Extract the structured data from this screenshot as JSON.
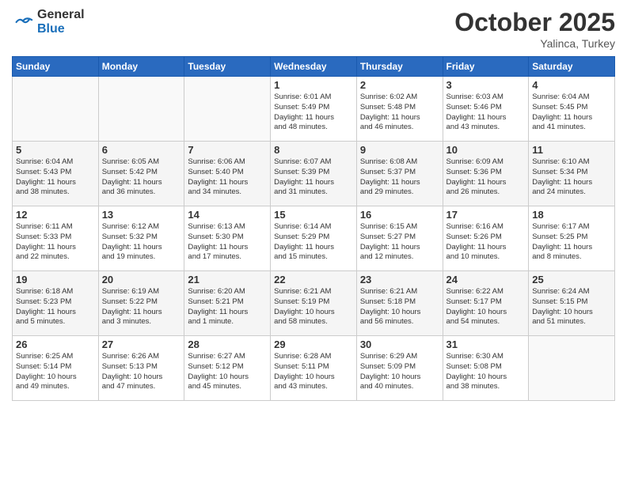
{
  "header": {
    "logo_general": "General",
    "logo_blue": "Blue",
    "month": "October 2025",
    "location": "Yalinca, Turkey"
  },
  "weekdays": [
    "Sunday",
    "Monday",
    "Tuesday",
    "Wednesday",
    "Thursday",
    "Friday",
    "Saturday"
  ],
  "weeks": [
    [
      {
        "day": "",
        "info": ""
      },
      {
        "day": "",
        "info": ""
      },
      {
        "day": "",
        "info": ""
      },
      {
        "day": "1",
        "info": "Sunrise: 6:01 AM\nSunset: 5:49 PM\nDaylight: 11 hours\nand 48 minutes."
      },
      {
        "day": "2",
        "info": "Sunrise: 6:02 AM\nSunset: 5:48 PM\nDaylight: 11 hours\nand 46 minutes."
      },
      {
        "day": "3",
        "info": "Sunrise: 6:03 AM\nSunset: 5:46 PM\nDaylight: 11 hours\nand 43 minutes."
      },
      {
        "day": "4",
        "info": "Sunrise: 6:04 AM\nSunset: 5:45 PM\nDaylight: 11 hours\nand 41 minutes."
      }
    ],
    [
      {
        "day": "5",
        "info": "Sunrise: 6:04 AM\nSunset: 5:43 PM\nDaylight: 11 hours\nand 38 minutes."
      },
      {
        "day": "6",
        "info": "Sunrise: 6:05 AM\nSunset: 5:42 PM\nDaylight: 11 hours\nand 36 minutes."
      },
      {
        "day": "7",
        "info": "Sunrise: 6:06 AM\nSunset: 5:40 PM\nDaylight: 11 hours\nand 34 minutes."
      },
      {
        "day": "8",
        "info": "Sunrise: 6:07 AM\nSunset: 5:39 PM\nDaylight: 11 hours\nand 31 minutes."
      },
      {
        "day": "9",
        "info": "Sunrise: 6:08 AM\nSunset: 5:37 PM\nDaylight: 11 hours\nand 29 minutes."
      },
      {
        "day": "10",
        "info": "Sunrise: 6:09 AM\nSunset: 5:36 PM\nDaylight: 11 hours\nand 26 minutes."
      },
      {
        "day": "11",
        "info": "Sunrise: 6:10 AM\nSunset: 5:34 PM\nDaylight: 11 hours\nand 24 minutes."
      }
    ],
    [
      {
        "day": "12",
        "info": "Sunrise: 6:11 AM\nSunset: 5:33 PM\nDaylight: 11 hours\nand 22 minutes."
      },
      {
        "day": "13",
        "info": "Sunrise: 6:12 AM\nSunset: 5:32 PM\nDaylight: 11 hours\nand 19 minutes."
      },
      {
        "day": "14",
        "info": "Sunrise: 6:13 AM\nSunset: 5:30 PM\nDaylight: 11 hours\nand 17 minutes."
      },
      {
        "day": "15",
        "info": "Sunrise: 6:14 AM\nSunset: 5:29 PM\nDaylight: 11 hours\nand 15 minutes."
      },
      {
        "day": "16",
        "info": "Sunrise: 6:15 AM\nSunset: 5:27 PM\nDaylight: 11 hours\nand 12 minutes."
      },
      {
        "day": "17",
        "info": "Sunrise: 6:16 AM\nSunset: 5:26 PM\nDaylight: 11 hours\nand 10 minutes."
      },
      {
        "day": "18",
        "info": "Sunrise: 6:17 AM\nSunset: 5:25 PM\nDaylight: 11 hours\nand 8 minutes."
      }
    ],
    [
      {
        "day": "19",
        "info": "Sunrise: 6:18 AM\nSunset: 5:23 PM\nDaylight: 11 hours\nand 5 minutes."
      },
      {
        "day": "20",
        "info": "Sunrise: 6:19 AM\nSunset: 5:22 PM\nDaylight: 11 hours\nand 3 minutes."
      },
      {
        "day": "21",
        "info": "Sunrise: 6:20 AM\nSunset: 5:21 PM\nDaylight: 11 hours\nand 1 minute."
      },
      {
        "day": "22",
        "info": "Sunrise: 6:21 AM\nSunset: 5:19 PM\nDaylight: 10 hours\nand 58 minutes."
      },
      {
        "day": "23",
        "info": "Sunrise: 6:21 AM\nSunset: 5:18 PM\nDaylight: 10 hours\nand 56 minutes."
      },
      {
        "day": "24",
        "info": "Sunrise: 6:22 AM\nSunset: 5:17 PM\nDaylight: 10 hours\nand 54 minutes."
      },
      {
        "day": "25",
        "info": "Sunrise: 6:24 AM\nSunset: 5:15 PM\nDaylight: 10 hours\nand 51 minutes."
      }
    ],
    [
      {
        "day": "26",
        "info": "Sunrise: 6:25 AM\nSunset: 5:14 PM\nDaylight: 10 hours\nand 49 minutes."
      },
      {
        "day": "27",
        "info": "Sunrise: 6:26 AM\nSunset: 5:13 PM\nDaylight: 10 hours\nand 47 minutes."
      },
      {
        "day": "28",
        "info": "Sunrise: 6:27 AM\nSunset: 5:12 PM\nDaylight: 10 hours\nand 45 minutes."
      },
      {
        "day": "29",
        "info": "Sunrise: 6:28 AM\nSunset: 5:11 PM\nDaylight: 10 hours\nand 43 minutes."
      },
      {
        "day": "30",
        "info": "Sunrise: 6:29 AM\nSunset: 5:09 PM\nDaylight: 10 hours\nand 40 minutes."
      },
      {
        "day": "31",
        "info": "Sunrise: 6:30 AM\nSunset: 5:08 PM\nDaylight: 10 hours\nand 38 minutes."
      },
      {
        "day": "",
        "info": ""
      }
    ]
  ]
}
